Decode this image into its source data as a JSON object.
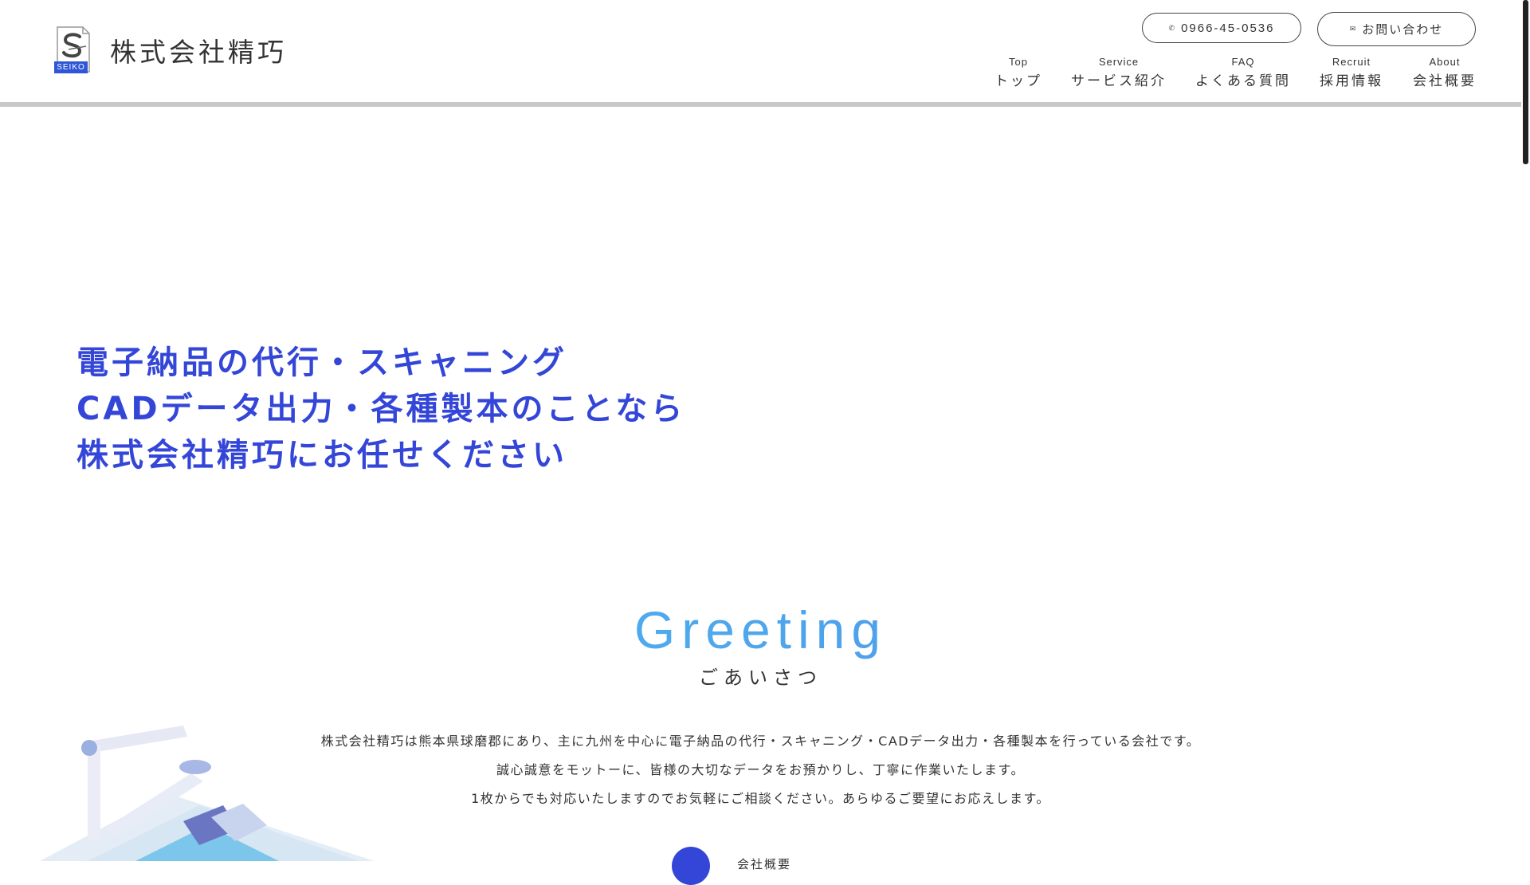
{
  "brand": {
    "name": "株式会社精巧",
    "logo_tag": "SEIKO"
  },
  "header": {
    "phone_label": "0966-45-0536",
    "contact_label": "お問い合わせ",
    "nav": [
      {
        "en": "Top",
        "ja": "トップ"
      },
      {
        "en": "Service",
        "ja": "サービス紹介"
      },
      {
        "en": "FAQ",
        "ja": "よくある質問"
      },
      {
        "en": "Recruit",
        "ja": "採用情報"
      },
      {
        "en": "About",
        "ja": "会社概要"
      }
    ]
  },
  "hero": {
    "lines": [
      "電子納品の代行・スキャニング",
      "CADデータ出力・各種製本のことなら",
      "株式会社精巧にお任せください"
    ]
  },
  "greeting": {
    "title": "Greeting",
    "subtitle": "ごあいさつ",
    "paragraphs": [
      "株式会社精巧は熊本県球磨郡にあり、主に九州を中心に電子納品の代行・スキャニング・CADデータ出力・各種製本を行っている会社です。",
      "誠心誠意をモットーに、皆様の大切なデータをお預かりし、丁寧に作業いたします。",
      "1枚からでも対応いたしますのでお気軽にご相談ください。あらゆるご要望にお応えします。"
    ],
    "link_label": "会社概要"
  },
  "colors": {
    "accent": "#3446d8",
    "greeting_gradient": [
      "#4fc2f0",
      "#4e8ae8"
    ]
  }
}
